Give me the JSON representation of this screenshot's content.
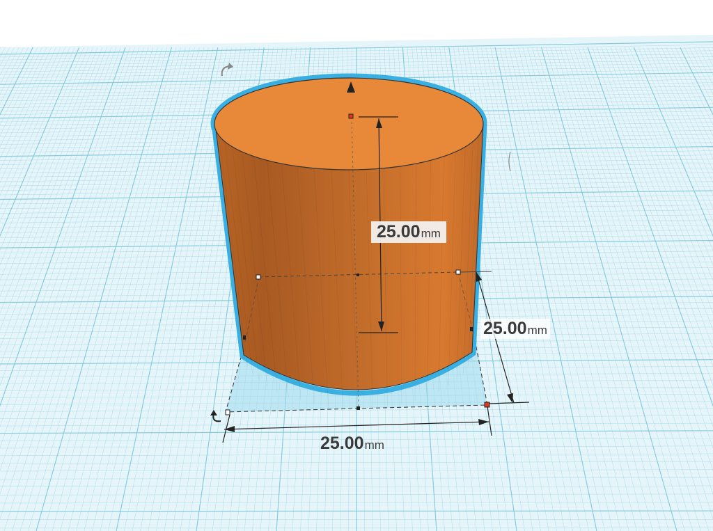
{
  "workplane": {
    "grid_color": "#7ec8dc",
    "plane_color": "#e6f5fa"
  },
  "shape": {
    "type": "cylinder",
    "fill_color": "#e8893a",
    "selection_outline_color": "#3ab0e2"
  },
  "dimensions": {
    "height": {
      "value": "25.00",
      "unit": "mm"
    },
    "depth": {
      "value": "25.00",
      "unit": "mm"
    },
    "width": {
      "value": "25.00",
      "unit": "mm"
    }
  },
  "icons": {
    "rotate_top": "rotate-arrow-icon",
    "rotate_bottom": "rotate-arrow-icon",
    "raise": "lift-arrow-icon"
  }
}
